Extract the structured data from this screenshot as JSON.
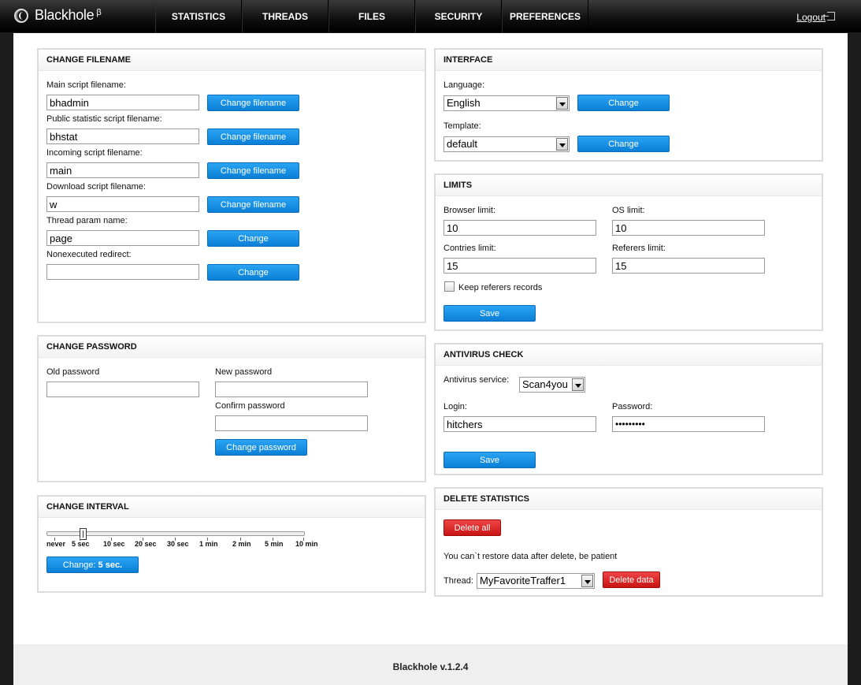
{
  "app": {
    "name": "Blackhole",
    "beta": "β",
    "version": "Blackhole v.1.2.4"
  },
  "nav": [
    {
      "label": "STATISTICS"
    },
    {
      "label": "THREADS"
    },
    {
      "label": "FILES"
    },
    {
      "label": "SECURITY"
    },
    {
      "label": "PREFERENCES"
    }
  ],
  "logout": "Logout",
  "change_filename": {
    "title": "CHANGE FILENAME",
    "fields": [
      {
        "label": "Main script filename:",
        "value": "bhadmin",
        "button": "Change filename"
      },
      {
        "label": "Public statistic script filename:",
        "value": "bhstat",
        "button": "Change filename"
      },
      {
        "label": "Incoming script filename:",
        "value": "main",
        "button": "Change filename"
      },
      {
        "label": "Download script filename:",
        "value": "w",
        "button": "Change filename"
      },
      {
        "label": "Thread param name:",
        "value": "page",
        "button": "Change"
      },
      {
        "label": "Nonexecuted redirect:",
        "value": "",
        "button": "Change"
      }
    ]
  },
  "change_password": {
    "title": "CHANGE PASSWORD",
    "old_label": "Old password",
    "new_label": "New password",
    "confirm_label": "Confirm password",
    "button": "Change password"
  },
  "change_interval": {
    "title": "CHANGE INTERVAL",
    "ticks": [
      "never",
      "5 sec",
      "10 sec",
      "20 sec",
      "30 sec",
      "1 min",
      "2 min",
      "5 min",
      "10 min"
    ],
    "selected_index": 1,
    "button_prefix": "Change: ",
    "button_value": "5 sec."
  },
  "interface": {
    "title": "INTERFACE",
    "language_label": "Language:",
    "language_value": "English",
    "template_label": "Template:",
    "template_value": "default",
    "button": "Change"
  },
  "limits": {
    "title": "LIMITS",
    "browser_label": "Browser limit:",
    "browser_value": "10",
    "os_label": "OS limit:",
    "os_value": "10",
    "countries_label": "Contries limit:",
    "countries_value": "15",
    "referers_label": "Referers limit:",
    "referers_value": "15",
    "keep_label": "Keep referers records",
    "keep_checked": false,
    "button": "Save"
  },
  "antivirus": {
    "title": "ANTIVIRUS CHECK",
    "service_label": "Antivirus service:",
    "service_value": "Scan4you",
    "login_label": "Login:",
    "login_value": "hitchers",
    "password_label": "Password:",
    "password_value": "•••••••••",
    "button": "Save"
  },
  "delete_stats": {
    "title": "DELETE STATISTICS",
    "delete_all": "Delete all",
    "warning": "You can`t restore data after delete, be patient",
    "thread_label": "Thread:",
    "thread_value": "MyFavoriteTraffer1",
    "delete_data": "Delete data"
  }
}
